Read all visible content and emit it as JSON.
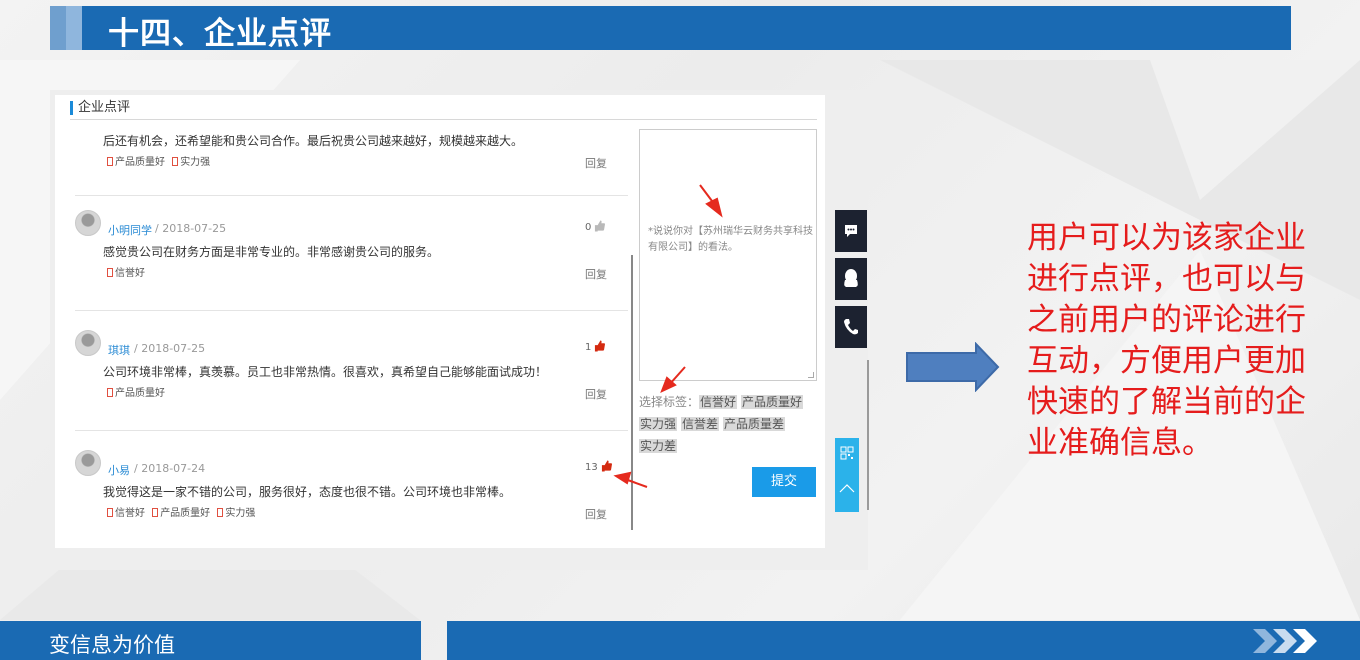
{
  "slide_title": "十四、企业点评",
  "panel": {
    "section_title": "企业点评",
    "reviews": [
      {
        "name": "",
        "date": "",
        "text": "后还有机会，还希望能和贵公司合作。最后祝贵公司越来越好，规模越来越大。",
        "tags": [
          "产品质量好",
          "实力强"
        ],
        "likes": "",
        "reply": "回复"
      },
      {
        "name": "小明同学",
        "date": "2018-07-25",
        "text": "感觉贵公司在财务方面是非常专业的。非常感谢贵公司的服务。",
        "tags": [
          "信誉好"
        ],
        "likes": "0",
        "reply": "回复"
      },
      {
        "name": "琪琪",
        "date": "2018-07-25",
        "text": "公司环境非常棒，真羡慕。员工也非常热情。很喜欢，真希望自己能够能面试成功！",
        "tags": [
          "产品质量好"
        ],
        "likes": "1",
        "reply": "回复"
      },
      {
        "name": "小易",
        "date": "2018-07-24",
        "text": "我觉得这是一家不错的公司，服务很好，态度也很不错。公司环境也非常棒。",
        "tags": [
          "信誉好",
          "产品质量好",
          "实力强"
        ],
        "likes": "13",
        "reply": "回复"
      }
    ],
    "comment_placeholder": "*说说你对【苏州瑞华云财务共享科技有限公司】的看法。",
    "tag_select_label": "选择标签：",
    "tag_options": [
      "信誉好",
      "产品质量好",
      "实力强",
      "信誉差",
      "产品质量差",
      "实力差"
    ],
    "submit_label": "提交"
  },
  "side_icons": [
    "chat-icon",
    "qq-icon",
    "phone-icon",
    "qrcode-icon",
    "back-to-top-icon"
  ],
  "caption": "用户可以为该家企业进行点评，也可以与之前用户的评论进行互动，方便用户更加快速的了解当前的企业准确信息。",
  "footer": {
    "slogan": "变信息为价值"
  },
  "colors": {
    "brand_blue": "#1a6ab3",
    "accent_blue": "#1a9be8",
    "caption_red": "#e51c1c",
    "arrow_blue": "#4f7fbf"
  }
}
